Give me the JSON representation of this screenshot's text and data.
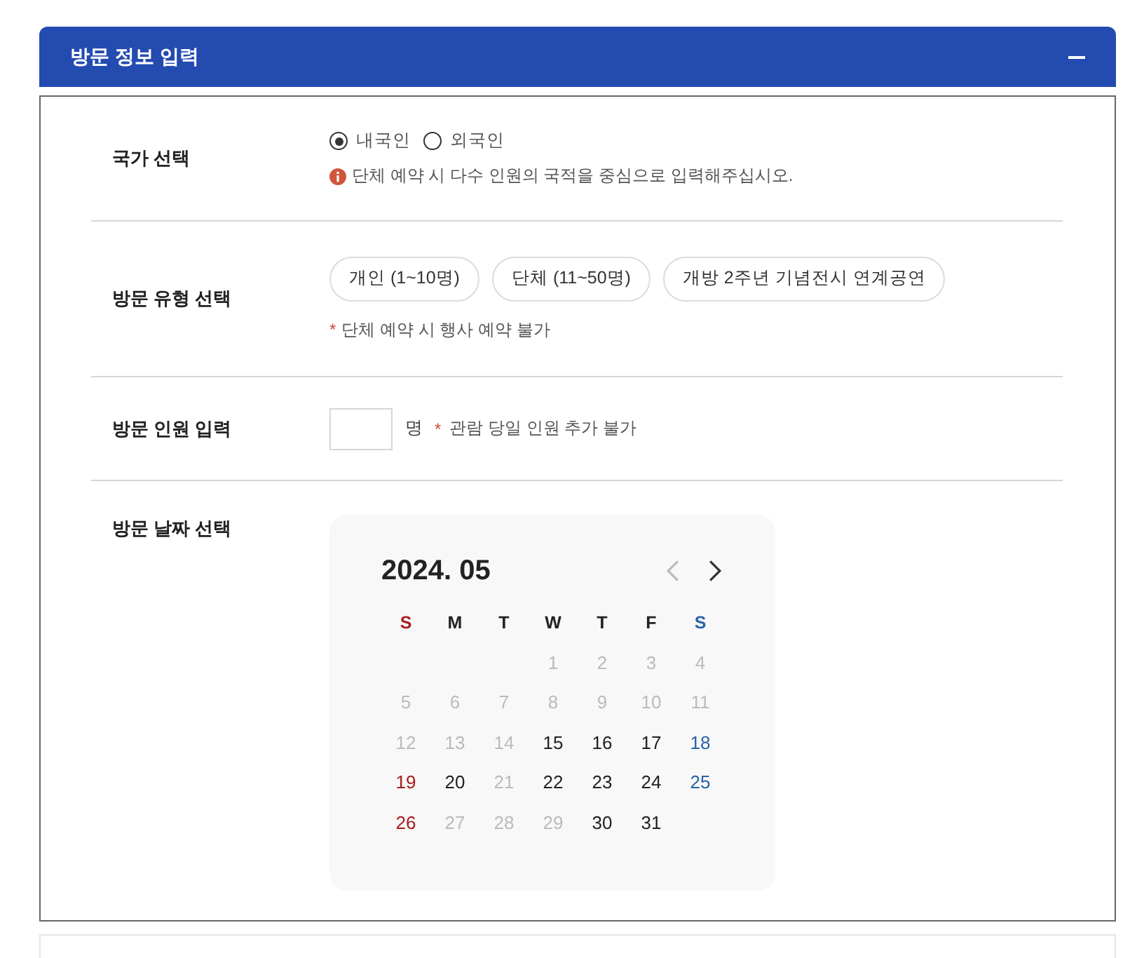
{
  "panel": {
    "title": "방문 정보 입력",
    "expanded": true
  },
  "fields": [
    {
      "kind": "radio",
      "label": "국가 선택",
      "options": [
        {
          "label": "내국인",
          "selected": true
        },
        {
          "label": "외국인",
          "selected": false
        }
      ],
      "notice": "단체 예약 시 다수 인원의 국적을 중심으로 입력해주십시오."
    },
    {
      "kind": "chips",
      "label": "방문 유형 선택",
      "options": [
        {
          "label": "개인 (1~10명)",
          "selected": false
        },
        {
          "label": "단체 (11~50명)",
          "selected": false
        },
        {
          "label": "개방 2주년 기념전시 연계공연",
          "selected": false
        }
      ],
      "mark": "*",
      "note": "단체 예약 시 행사 예약 불가"
    },
    {
      "kind": "number",
      "label": "방문 인원 입력",
      "unit": "명",
      "mark": "*",
      "note": "관람 당일 인원 추가 불가"
    },
    {
      "kind": "calendar",
      "label": "방문 날짜 선택",
      "calendar": {
        "title": "2024. 05",
        "nav": [
          {
            "kind": "prev",
            "disabled": true
          },
          {
            "kind": "next",
            "disabled": false
          }
        ],
        "weekdays": [
          "S",
          "M",
          "T",
          "W",
          "T",
          "F",
          "S"
        ],
        "weeks": [
          [
            {
              "label": "1",
              "disabled": true
            },
            {
              "label": "2",
              "disabled": true
            },
            {
              "label": "3",
              "disabled": true
            },
            {
              "label": "4",
              "disabled": true
            }
          ],
          [
            {
              "label": "5",
              "disabled": true
            },
            {
              "label": "6",
              "disabled": true
            },
            {
              "label": "7",
              "disabled": true
            },
            {
              "label": "8",
              "disabled": true
            },
            {
              "label": "9",
              "disabled": true
            },
            {
              "label": "10",
              "disabled": true
            },
            {
              "label": "11",
              "disabled": true
            }
          ],
          [
            {
              "label": "12",
              "disabled": true
            },
            {
              "label": "13",
              "disabled": true
            },
            {
              "label": "14",
              "disabled": true
            },
            {
              "label": "15",
              "disabled": false
            },
            {
              "label": "16",
              "disabled": false
            },
            {
              "label": "17",
              "disabled": false
            },
            {
              "label": "18",
              "disabled": false
            }
          ],
          [
            {
              "label": "19",
              "disabled": false
            },
            {
              "label": "20",
              "disabled": false
            },
            {
              "label": "21",
              "disabled": true
            },
            {
              "label": "22",
              "disabled": false
            },
            {
              "label": "23",
              "disabled": false
            },
            {
              "label": "24",
              "disabled": false
            },
            {
              "label": "25",
              "disabled": false
            }
          ],
          [
            {
              "label": "26",
              "disabled": false
            },
            {
              "label": "27",
              "disabled": true
            },
            {
              "label": "28",
              "disabled": true
            },
            {
              "label": "29",
              "disabled": true
            },
            {
              "label": "30",
              "disabled": false
            },
            {
              "label": "31",
              "disabled": false
            }
          ]
        ]
      }
    }
  ],
  "next_panel": {
    "expanded": false
  }
}
